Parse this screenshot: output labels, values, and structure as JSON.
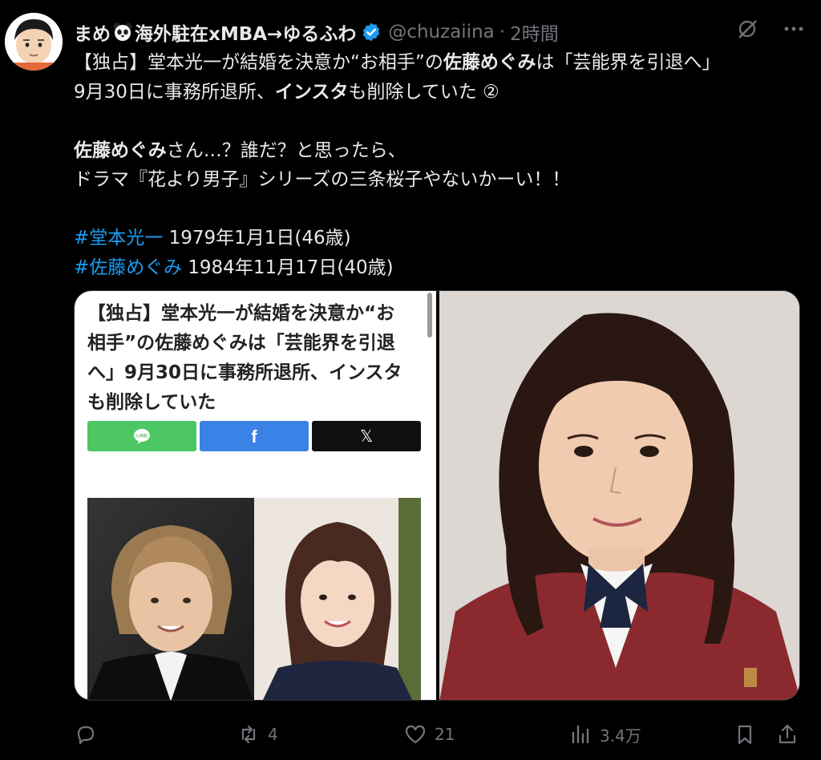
{
  "tweet": {
    "author_name_part1": "まめ",
    "author_name_part2": "海外駐在xMBA→ゆるふわ",
    "handle": "@chuzaiina",
    "separator": "·",
    "time": "2時間",
    "lines": [
      [
        {
          "t": "【独占】堂本光一が結婚を決意か“お相手”の"
        },
        {
          "t": "佐藤めぐみ",
          "b": true
        },
        {
          "t": "は「芸能界を引退へ」"
        }
      ],
      [
        {
          "t": "9月30日に事務所退所、"
        },
        {
          "t": "インスタ",
          "b": true
        },
        {
          "t": "も削除していた ②"
        }
      ],
      [],
      [
        {
          "t": "佐藤めぐみ",
          "b": true
        },
        {
          "t": "さん…？誰だ？と思ったら、"
        }
      ],
      [
        {
          "t": "ドラマ『花より男子』シリーズの三条桜子やないかーい！！"
        }
      ],
      [],
      [
        {
          "t": "#堂本光一",
          "h": true
        },
        {
          "t": " 1979年1月1日(46歳)"
        }
      ],
      [
        {
          "t": "#佐藤めぐみ",
          "h": true
        },
        {
          "t": " 1984年11月17日(40歳)"
        }
      ]
    ]
  },
  "card": {
    "article_title": "【独占】堂本光一が結婚を決意か“お相手”の佐藤めぐみは「芸能界を引退へ」9月30日に事務所退所、インスタも削除していた",
    "share_line": "LINE",
    "share_facebook": "f",
    "share_x": "𝕏"
  },
  "actions": {
    "replies": "",
    "reposts": "4",
    "likes": "21",
    "views": "3.4万"
  },
  "colors": {
    "background": "#000000",
    "text": "#e7e9ea",
    "muted": "#71767b",
    "link": "#1d9bf0",
    "verified": "#1d9bf0",
    "line_green": "#4cc764",
    "facebook_blue": "#3b82e6",
    "uniform_red": "#8b2a2e"
  },
  "icons": [
    "avatar-cartoon",
    "panda-emoji",
    "verified-badge-icon",
    "grok-icon",
    "more-icon",
    "reply-icon",
    "repost-icon",
    "like-icon",
    "views-icon",
    "bookmark-icon",
    "share-icon"
  ]
}
